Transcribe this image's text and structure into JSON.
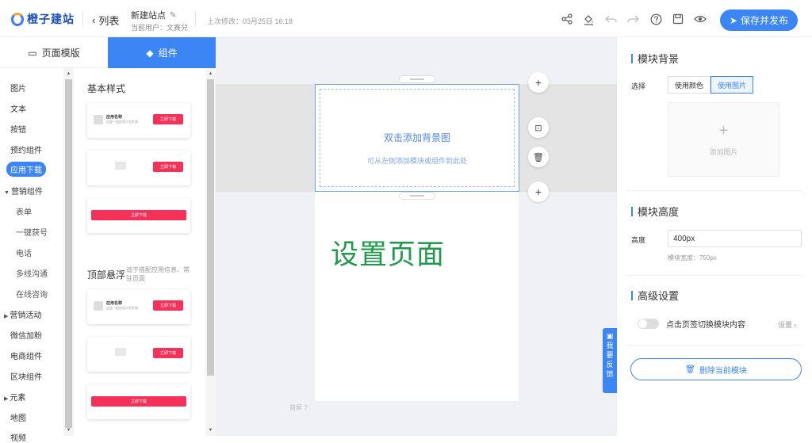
{
  "header": {
    "logo_text": "橙子建站",
    "back_label": "列表",
    "site_title": "新建站点",
    "site_user": "当前用户：文赛兒",
    "last_modified": "上次修改：03月25日 16:18",
    "save_label": "保存并发布",
    "accent": "#3b85f5"
  },
  "left_tabs": [
    {
      "label": "页面模版",
      "icon": "page-template-icon"
    },
    {
      "label": "组件",
      "icon": "component-icon"
    }
  ],
  "categories": [
    {
      "label": "图片"
    },
    {
      "label": "文本"
    },
    {
      "label": "按钮"
    },
    {
      "label": "预约组件"
    },
    {
      "label": "应用下载"
    },
    {
      "label": "营销组件"
    },
    {
      "label": "表单"
    },
    {
      "label": "一键获号"
    },
    {
      "label": "电话"
    },
    {
      "label": "多线沟通"
    },
    {
      "label": "在线咨询"
    },
    {
      "label": "营销活动"
    },
    {
      "label": "微信加粉"
    },
    {
      "label": "电商组件"
    },
    {
      "label": "区块组件"
    },
    {
      "label": "元素"
    },
    {
      "label": "地图"
    },
    {
      "label": "视频"
    }
  ],
  "components": {
    "basic_title": "基本样式",
    "top_title": "顶部悬浮",
    "top_note": "适于搭配应用信息、常驻页面",
    "app_name": "应用名称",
    "app_desc": "这里一段应用介绍文案",
    "download_label": "立即下载"
  },
  "canvas": {
    "bg_main": "双击添加背景图",
    "bg_sub": "可从左侧添加模块或组件到此处",
    "page_text": "设置页面",
    "ghost_label": "首屏",
    "page_text_color": "#1f9a4a"
  },
  "feedback": {
    "chars": [
      "我",
      "要",
      "反",
      "馈"
    ]
  },
  "right_panel": {
    "bg_title": "模块背景",
    "choose_label": "选择",
    "use_color": "使用颜色",
    "use_image": "使用图片",
    "add_image": "添加图片",
    "height_title": "模块高度",
    "height_label": "高度",
    "height_value": "400px",
    "width_note": "模块宽度：750px",
    "advanced_title": "高级设置",
    "toggle_label": "点击页签切换模块内容",
    "settings_label": "设置",
    "delete_label": "删除当前模块"
  }
}
